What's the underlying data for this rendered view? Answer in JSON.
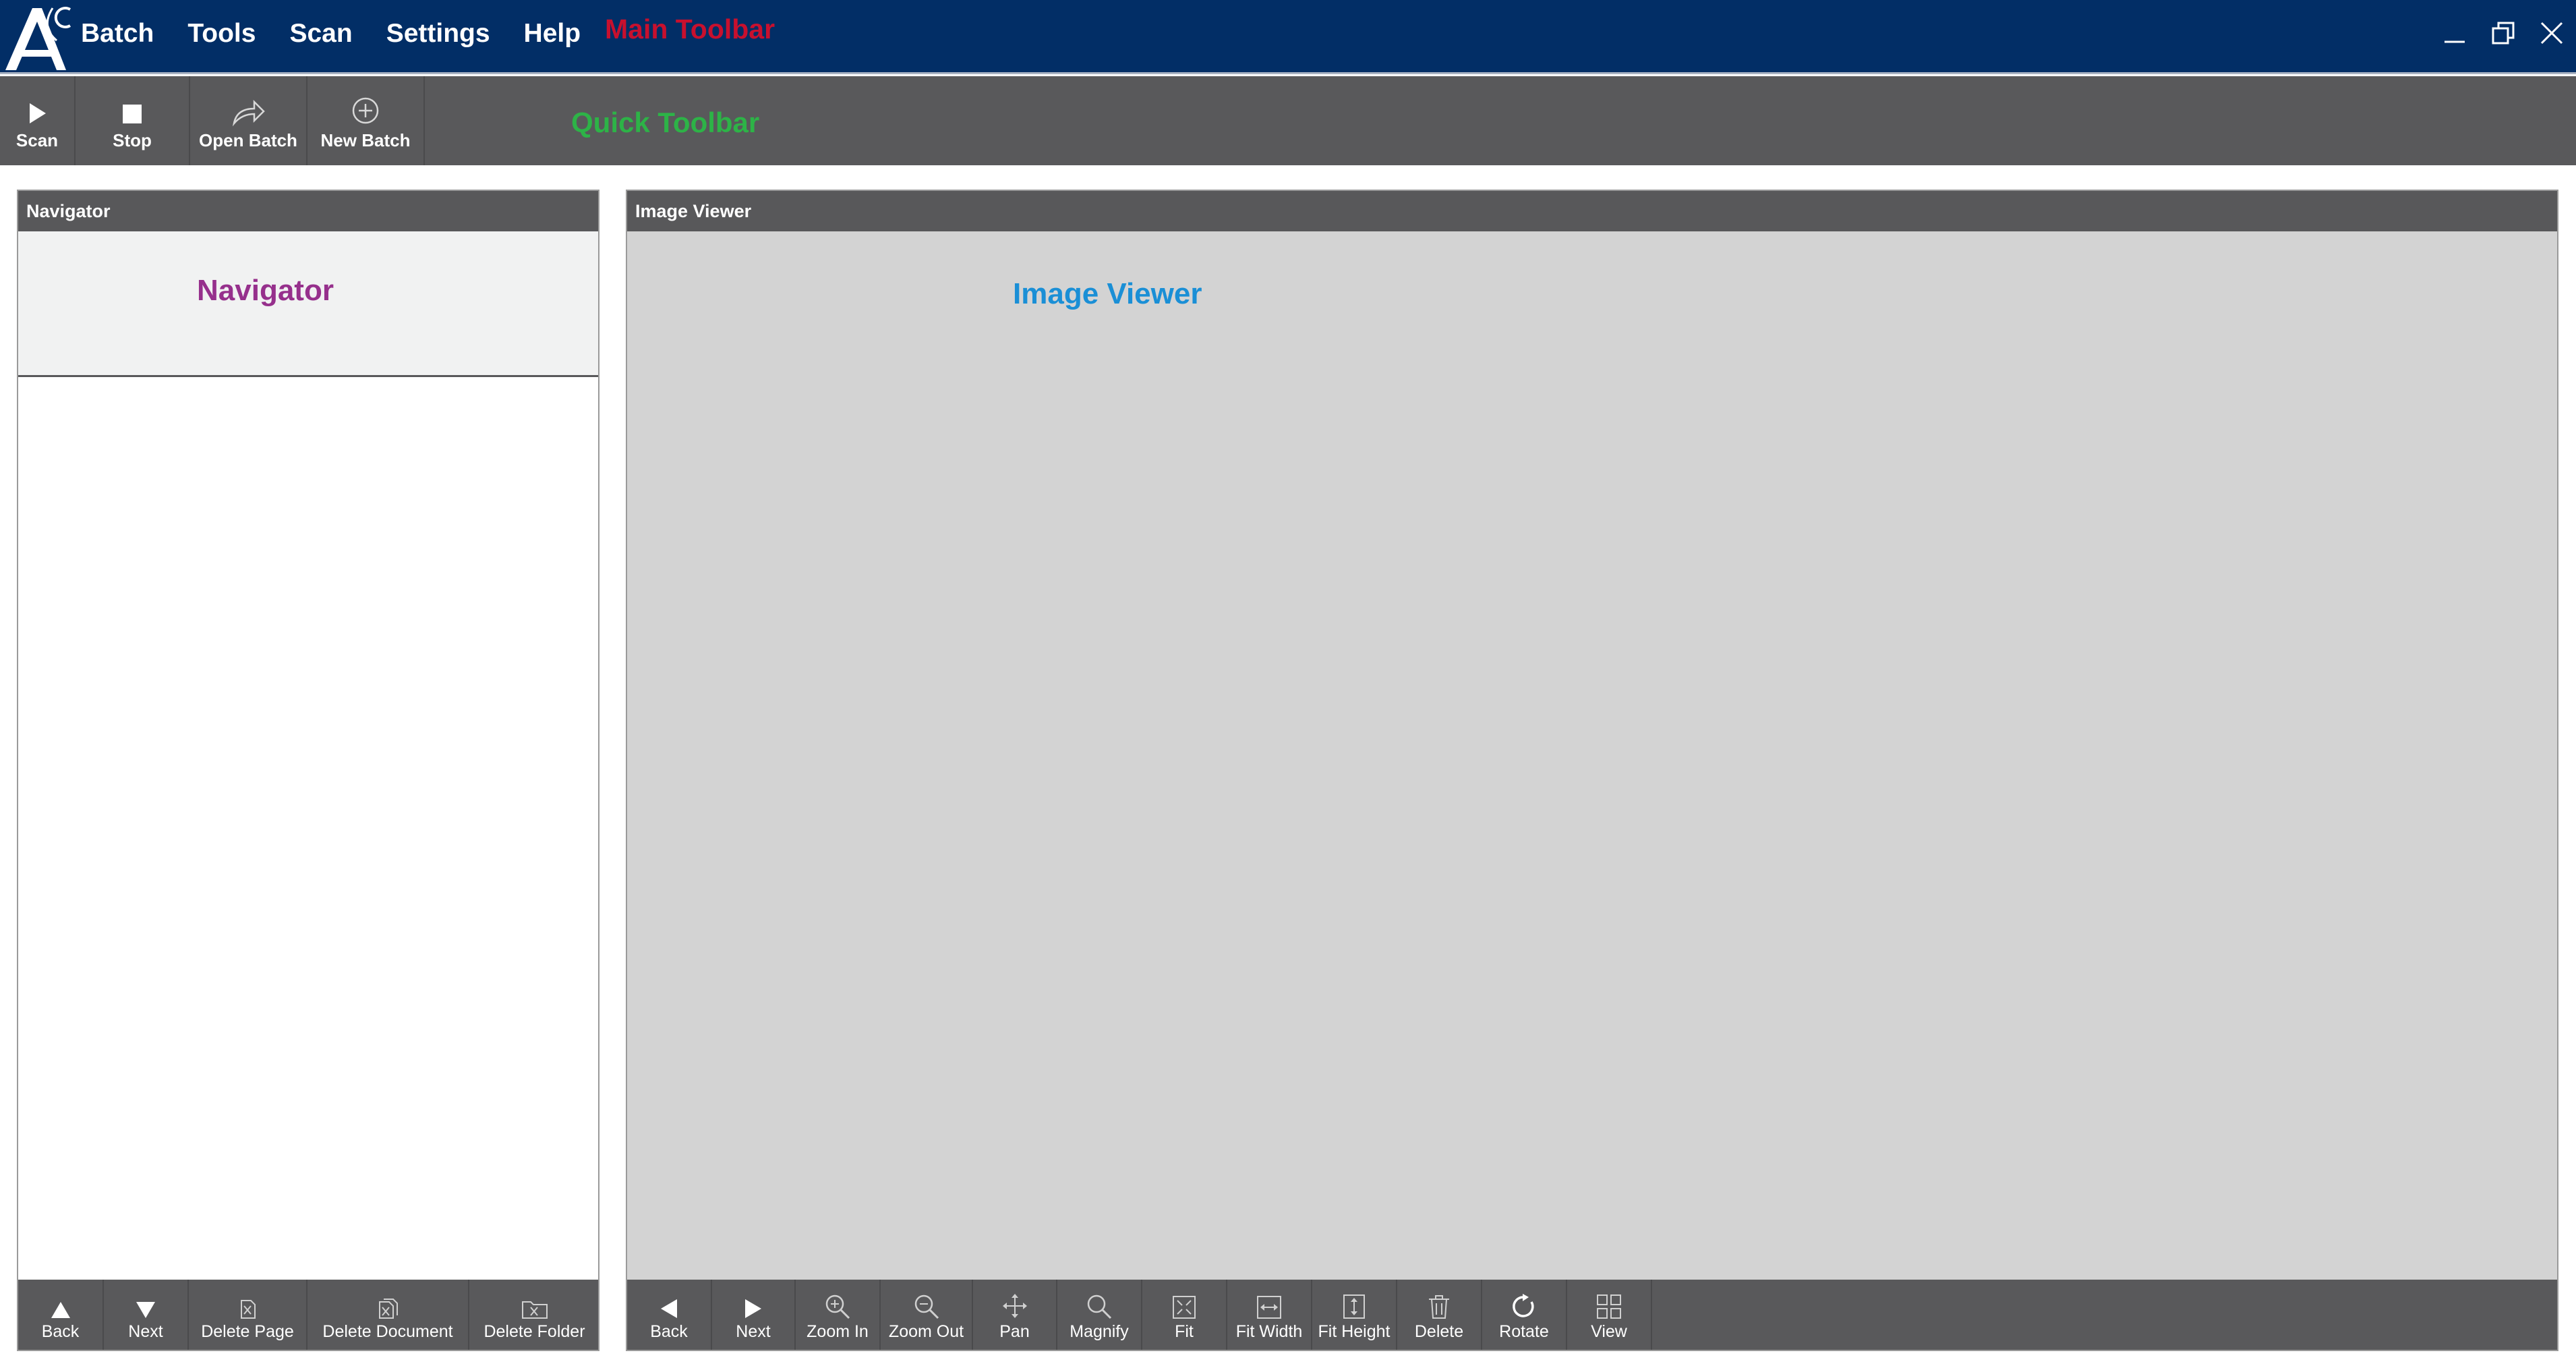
{
  "colors": {
    "title_bar": "#022e66",
    "toolbar": "#59595b",
    "main_toolbar_label": "#c8102e",
    "quick_toolbar_label": "#2db347",
    "navigator_label": "#96308c",
    "image_viewer_label": "#1a8fd6",
    "viewer_background": "#d3d3d3"
  },
  "menu": {
    "items": [
      "Batch",
      "Tools",
      "Scan",
      "Settings",
      "Help"
    ],
    "annotation": "Main Toolbar"
  },
  "logo": {
    "text": "AC"
  },
  "window_controls": [
    "minimize-icon",
    "restore-icon",
    "close-icon"
  ],
  "quick_toolbar": {
    "annotation": "Quick Toolbar",
    "buttons": [
      {
        "label": "Scan",
        "icon": "play-icon"
      },
      {
        "label": "Stop",
        "icon": "stop-icon"
      },
      {
        "label": "Open Batch",
        "icon": "open-arrow-icon"
      },
      {
        "label": "New Batch",
        "icon": "plus-circle-icon"
      }
    ]
  },
  "navigator": {
    "title": "Navigator",
    "annotation": "Navigator",
    "buttons": [
      {
        "label": "Back",
        "icon": "arrow-up-icon"
      },
      {
        "label": "Next",
        "icon": "arrow-down-icon"
      },
      {
        "label": "Delete Page",
        "icon": "delete-page-icon"
      },
      {
        "label": "Delete Document",
        "icon": "delete-document-icon"
      },
      {
        "label": "Delete Folder",
        "icon": "delete-folder-icon"
      }
    ]
  },
  "image_viewer": {
    "title": "Image Viewer",
    "annotation": "Image Viewer",
    "buttons": [
      {
        "label": "Back",
        "icon": "arrow-left-icon"
      },
      {
        "label": "Next",
        "icon": "arrow-right-icon"
      },
      {
        "label": "Zoom In",
        "icon": "zoom-in-icon"
      },
      {
        "label": "Zoom Out",
        "icon": "zoom-out-icon"
      },
      {
        "label": "Pan",
        "icon": "pan-icon"
      },
      {
        "label": "Magnify",
        "icon": "magnify-icon"
      },
      {
        "label": "Fit",
        "icon": "fit-icon"
      },
      {
        "label": "Fit Width",
        "icon": "fit-width-icon"
      },
      {
        "label": "Fit Height",
        "icon": "fit-height-icon"
      },
      {
        "label": "Delete",
        "icon": "trash-icon"
      },
      {
        "label": "Rotate",
        "icon": "rotate-icon"
      },
      {
        "label": "View",
        "icon": "grid-view-icon"
      }
    ]
  }
}
